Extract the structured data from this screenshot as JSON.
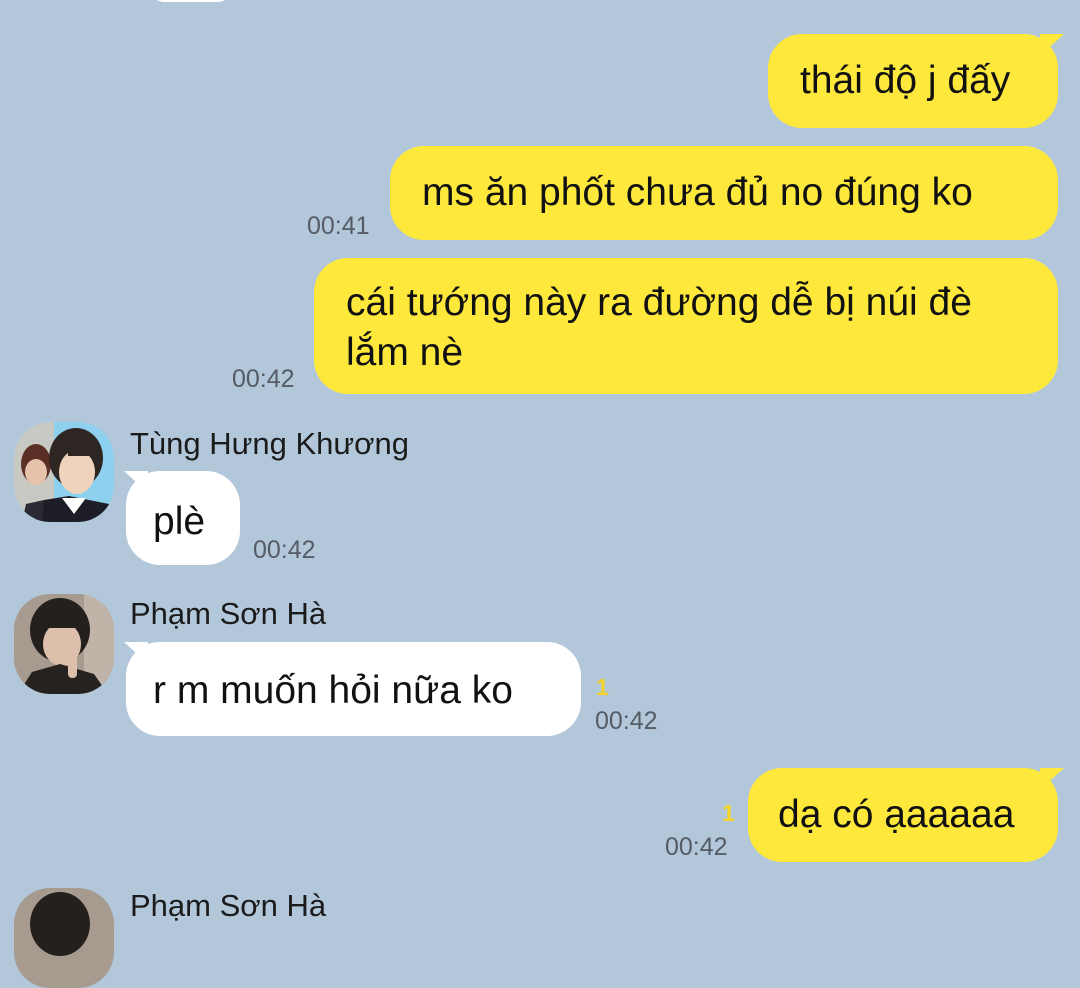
{
  "messages": [
    {
      "text": "thái độ j đấy"
    },
    {
      "text": "ms ăn phốt chưa đủ no đúng ko",
      "time": "00:41"
    },
    {
      "line1": "cái tướng này ra đường dễ bị núi đè",
      "line2": "lắm nè",
      "time": "00:42"
    },
    {
      "sender": "Tùng Hưng Khương",
      "text": "plè",
      "time": "00:42"
    },
    {
      "sender": "Phạm Sơn Hà",
      "text": "r m muốn hỏi nữa ko",
      "time": "00:42",
      "unread": "1"
    },
    {
      "text": "dạ có ạaaaaa",
      "time": "00:42",
      "unread": "1"
    },
    {
      "sender": "Phạm Sơn Hà"
    }
  ],
  "colors": {
    "background": "#b2c7da",
    "my_bubble": "#fee83c",
    "their_bubble": "#ffffff",
    "unread": "#f5d327"
  }
}
